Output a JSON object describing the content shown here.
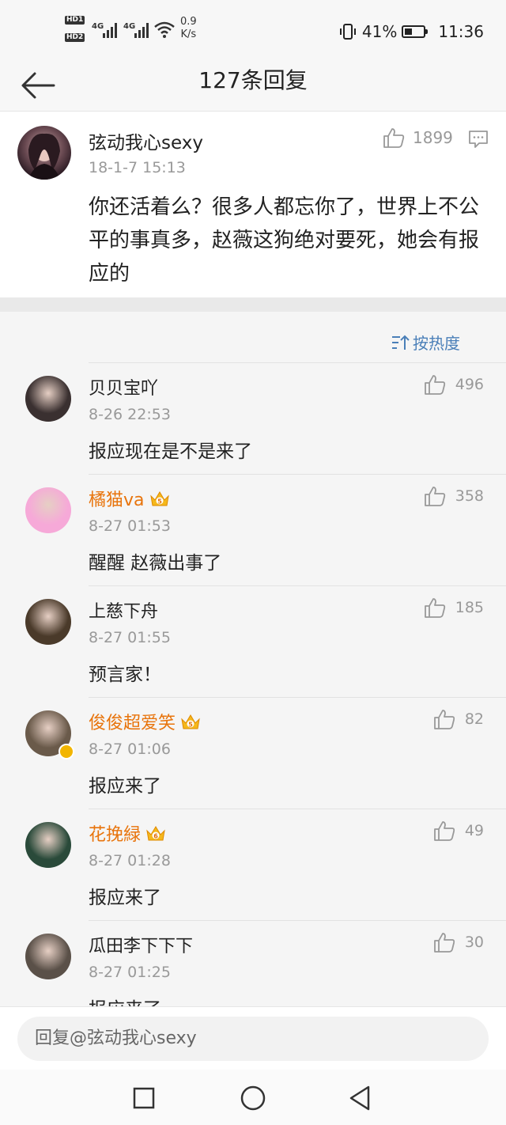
{
  "status_bar": {
    "hd1": "HD1",
    "hd2": "HD2",
    "signal1": "4G",
    "signal2": "4G",
    "net_speed_value": "0.9",
    "net_speed_unit": "K/s",
    "battery": "41%",
    "battery_level": 0.41,
    "time": "11:36"
  },
  "header": {
    "title": "127条回复"
  },
  "main_comment": {
    "author": "弦动我心sexy",
    "time": "18-1-7 15:13",
    "likes": "1899",
    "text": "你还活着么？很多人都忘你了，世界上不公平的事真多，赵薇这狗绝对要死，她会有报应的"
  },
  "sort": {
    "label": "按热度"
  },
  "replies": [
    {
      "author": "贝贝宝吖",
      "vip": false,
      "crown": "",
      "verified": false,
      "time": "8-26 22:53",
      "likes": "496",
      "text": "报应现在是不是来了",
      "avatar_color": "#3a3030"
    },
    {
      "author": "橘猫va",
      "vip": true,
      "crown": "5",
      "verified": false,
      "time": "8-27 01:53",
      "likes": "358",
      "text": "醒醒 赵薇出事了",
      "avatar_color": "#f6a9d8"
    },
    {
      "author": "上慈下舟",
      "vip": false,
      "crown": "",
      "verified": false,
      "time": "8-27 01:55",
      "likes": "185",
      "text": "预言家！",
      "avatar_color": "#4a3a2a"
    },
    {
      "author": "俊俊超爱笑",
      "vip": true,
      "crown": "5",
      "verified": true,
      "time": "8-27 01:06",
      "likes": "82",
      "text": "报应来了",
      "avatar_color": "#6a5a4a"
    },
    {
      "author": "花挽緑",
      "vip": true,
      "crown": "6",
      "verified": false,
      "time": "8-27 01:28",
      "likes": "49",
      "text": "报应来了",
      "avatar_color": "#2a4a3a"
    },
    {
      "author": "瓜田李下下下",
      "vip": false,
      "crown": "",
      "verified": false,
      "time": "8-27 01:25",
      "likes": "30",
      "text": "报应来了",
      "avatar_color": "#5a5048"
    }
  ],
  "input": {
    "placeholder": "回复@弦动我心sexy"
  },
  "icons": {
    "back": "arrow-left-icon",
    "like": "thumbs-up-icon",
    "comment": "comment-icon",
    "sort": "sort-icon",
    "nav_recent": "square-icon",
    "nav_home": "circle-icon",
    "nav_back": "triangle-back-icon"
  }
}
